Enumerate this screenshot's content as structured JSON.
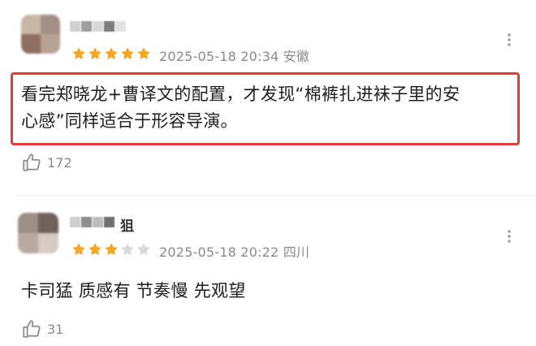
{
  "comments": [
    {
      "username_visible": "",
      "rating": 5,
      "rating_max": 5,
      "date": "2025-05-18 20:34",
      "location": "安徽",
      "text_line1": "看完郑晓龙+曹译文的配置，才发现“棉裤扎进袜子里的安",
      "text_line2": "心感”同样适合于形容导演。",
      "likes": "172",
      "highlighted": true
    },
    {
      "username_visible": "狙",
      "rating": 3,
      "rating_max": 5,
      "date": "2025-05-18 20:22",
      "location": "四川",
      "text_line1": "卡司猛 质感有 节奏慢 先观望",
      "likes": "31",
      "highlighted": false
    }
  ],
  "colors": {
    "star_filled": "#f5a623",
    "star_empty": "#d9d9d9",
    "highlight_border": "#e23b3b",
    "meta_text": "#8a8a8a"
  },
  "icons": [
    "more-vertical-icon",
    "thumbs-up-icon",
    "star-icon"
  ]
}
